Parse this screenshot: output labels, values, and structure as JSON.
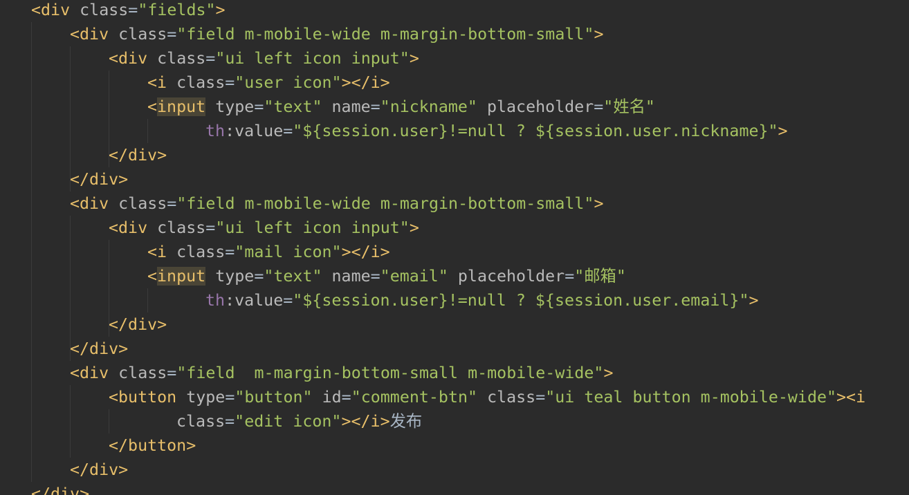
{
  "editor": {
    "language": "html-thymeleaf",
    "colors": {
      "background": "#2b2b2b",
      "tag": "#e8bf6a",
      "attribute": "#bababa",
      "string": "#a5c261",
      "namespace": "#9876aa",
      "text": "#a9b7c6",
      "highlight_bg": "#4a4536",
      "indent_guide": "#3b3b3b"
    },
    "lines": [
      {
        "indent": 1,
        "tokens": [
          {
            "t": "tag",
            "v": "<div"
          },
          {
            "t": "text",
            "v": " "
          },
          {
            "t": "attr",
            "v": "class"
          },
          {
            "t": "punc",
            "v": "="
          },
          {
            "t": "str",
            "v": "\"fields\""
          },
          {
            "t": "tag",
            "v": ">"
          }
        ]
      },
      {
        "indent": 2,
        "tokens": [
          {
            "t": "tag",
            "v": "<div"
          },
          {
            "t": "text",
            "v": " "
          },
          {
            "t": "attr",
            "v": "class"
          },
          {
            "t": "punc",
            "v": "="
          },
          {
            "t": "str",
            "v": "\"field m-mobile-wide m-margin-bottom-small\""
          },
          {
            "t": "tag",
            "v": ">"
          }
        ]
      },
      {
        "indent": 3,
        "tokens": [
          {
            "t": "tag",
            "v": "<div"
          },
          {
            "t": "text",
            "v": " "
          },
          {
            "t": "attr",
            "v": "class"
          },
          {
            "t": "punc",
            "v": "="
          },
          {
            "t": "str",
            "v": "\"ui left icon input\""
          },
          {
            "t": "tag",
            "v": ">"
          }
        ]
      },
      {
        "indent": 4,
        "tokens": [
          {
            "t": "tag",
            "v": "<i"
          },
          {
            "t": "text",
            "v": " "
          },
          {
            "t": "attr",
            "v": "class"
          },
          {
            "t": "punc",
            "v": "="
          },
          {
            "t": "str",
            "v": "\"user icon\""
          },
          {
            "t": "tag",
            "v": "></i>"
          }
        ]
      },
      {
        "indent": 4,
        "tokens": [
          {
            "t": "tag",
            "v": "<"
          },
          {
            "t": "hl",
            "v": "input"
          },
          {
            "t": "text",
            "v": " "
          },
          {
            "t": "attr",
            "v": "type"
          },
          {
            "t": "punc",
            "v": "="
          },
          {
            "t": "str",
            "v": "\"text\""
          },
          {
            "t": "text",
            "v": " "
          },
          {
            "t": "attr",
            "v": "name"
          },
          {
            "t": "punc",
            "v": "="
          },
          {
            "t": "str",
            "v": "\"nickname\""
          },
          {
            "t": "text",
            "v": " "
          },
          {
            "t": "attr",
            "v": "placeholder"
          },
          {
            "t": "punc",
            "v": "="
          },
          {
            "t": "str",
            "v": "\"姓名\""
          }
        ]
      },
      {
        "indent": 5.5,
        "tokens": [
          {
            "t": "ns",
            "v": "th"
          },
          {
            "t": "attr",
            "v": ":value"
          },
          {
            "t": "punc",
            "v": "="
          },
          {
            "t": "str",
            "v": "\"${session.user}!=null ? ${session.user.nickname}\""
          },
          {
            "t": "tag",
            "v": ">"
          }
        ]
      },
      {
        "indent": 3,
        "tokens": [
          {
            "t": "tag",
            "v": "</div>"
          }
        ]
      },
      {
        "indent": 2,
        "tokens": [
          {
            "t": "tag",
            "v": "</div>"
          }
        ]
      },
      {
        "indent": 2,
        "tokens": [
          {
            "t": "tag",
            "v": "<div"
          },
          {
            "t": "text",
            "v": " "
          },
          {
            "t": "attr",
            "v": "class"
          },
          {
            "t": "punc",
            "v": "="
          },
          {
            "t": "str",
            "v": "\"field m-mobile-wide m-margin-bottom-small\""
          },
          {
            "t": "tag",
            "v": ">"
          }
        ]
      },
      {
        "indent": 3,
        "tokens": [
          {
            "t": "tag",
            "v": "<div"
          },
          {
            "t": "text",
            "v": " "
          },
          {
            "t": "attr",
            "v": "class"
          },
          {
            "t": "punc",
            "v": "="
          },
          {
            "t": "str",
            "v": "\"ui left icon input\""
          },
          {
            "t": "tag",
            "v": ">"
          }
        ]
      },
      {
        "indent": 4,
        "tokens": [
          {
            "t": "tag",
            "v": "<i"
          },
          {
            "t": "text",
            "v": " "
          },
          {
            "t": "attr",
            "v": "class"
          },
          {
            "t": "punc",
            "v": "="
          },
          {
            "t": "str",
            "v": "\"mail icon\""
          },
          {
            "t": "tag",
            "v": "></i>"
          }
        ]
      },
      {
        "indent": 4,
        "tokens": [
          {
            "t": "tag",
            "v": "<"
          },
          {
            "t": "hl",
            "v": "input"
          },
          {
            "t": "text",
            "v": " "
          },
          {
            "t": "attr",
            "v": "type"
          },
          {
            "t": "punc",
            "v": "="
          },
          {
            "t": "str",
            "v": "\"text\""
          },
          {
            "t": "text",
            "v": " "
          },
          {
            "t": "attr",
            "v": "name"
          },
          {
            "t": "punc",
            "v": "="
          },
          {
            "t": "str",
            "v": "\"email\""
          },
          {
            "t": "text",
            "v": " "
          },
          {
            "t": "attr",
            "v": "placeholder"
          },
          {
            "t": "punc",
            "v": "="
          },
          {
            "t": "str",
            "v": "\"邮箱\""
          }
        ]
      },
      {
        "indent": 5.5,
        "tokens": [
          {
            "t": "ns",
            "v": "th"
          },
          {
            "t": "attr",
            "v": ":value"
          },
          {
            "t": "punc",
            "v": "="
          },
          {
            "t": "str",
            "v": "\"${session.user}!=null ? ${session.user.email}\""
          },
          {
            "t": "tag",
            "v": ">"
          }
        ]
      },
      {
        "indent": 3,
        "tokens": [
          {
            "t": "tag",
            "v": "</div>"
          }
        ]
      },
      {
        "indent": 2,
        "tokens": [
          {
            "t": "tag",
            "v": "</div>"
          }
        ]
      },
      {
        "indent": 2,
        "tokens": [
          {
            "t": "tag",
            "v": "<div"
          },
          {
            "t": "text",
            "v": " "
          },
          {
            "t": "attr",
            "v": "class"
          },
          {
            "t": "punc",
            "v": "="
          },
          {
            "t": "str",
            "v": "\"field  m-margin-bottom-small m-mobile-wide\""
          },
          {
            "t": "tag",
            "v": ">"
          }
        ]
      },
      {
        "indent": 3,
        "tokens": [
          {
            "t": "tag",
            "v": "<button"
          },
          {
            "t": "text",
            "v": " "
          },
          {
            "t": "attr",
            "v": "type"
          },
          {
            "t": "punc",
            "v": "="
          },
          {
            "t": "str",
            "v": "\"button\""
          },
          {
            "t": "text",
            "v": " "
          },
          {
            "t": "attr",
            "v": "id"
          },
          {
            "t": "punc",
            "v": "="
          },
          {
            "t": "str",
            "v": "\"comment-btn\""
          },
          {
            "t": "text",
            "v": " "
          },
          {
            "t": "attr",
            "v": "class"
          },
          {
            "t": "punc",
            "v": "="
          },
          {
            "t": "str",
            "v": "\"ui teal button m-mobile-wide\""
          },
          {
            "t": "tag",
            "v": "><i"
          }
        ]
      },
      {
        "indent": 4.75,
        "tokens": [
          {
            "t": "attr",
            "v": "class"
          },
          {
            "t": "punc",
            "v": "="
          },
          {
            "t": "str",
            "v": "\"edit icon\""
          },
          {
            "t": "tag",
            "v": "></i>"
          },
          {
            "t": "text",
            "v": "发布"
          }
        ]
      },
      {
        "indent": 3,
        "tokens": [
          {
            "t": "tag",
            "v": "</button>"
          }
        ]
      },
      {
        "indent": 2,
        "tokens": [
          {
            "t": "tag",
            "v": "</div>"
          }
        ]
      },
      {
        "indent": 1,
        "tokens": [
          {
            "t": "tag",
            "v": "</div>"
          }
        ]
      }
    ]
  }
}
